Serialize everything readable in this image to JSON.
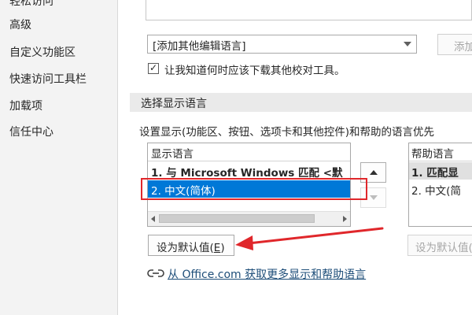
{
  "sidebar": {
    "items": [
      {
        "label": "轻松访问"
      },
      {
        "label": "高级"
      },
      {
        "label": "自定义功能区"
      },
      {
        "label": "快速访问工具栏"
      },
      {
        "label": "加载项"
      },
      {
        "label": "信任中心"
      }
    ]
  },
  "editing_language": {
    "select_value": "[添加其他编辑语言]",
    "add_button": "添加"
  },
  "proofing_notice": {
    "checked": true,
    "check_glyph": "✓",
    "label": "让我知道何时应该下载其他校对工具。"
  },
  "display_section": {
    "header": "选择显示语言",
    "description": "设置显示(功能区、按钮、选项卡和其他控件)和帮助的语言优先",
    "display_list": {
      "header": "显示语言",
      "rows": [
        {
          "label": "1.    与 Microsoft Windows 匹配 <默"
        },
        {
          "label": "2.    中文(简体)",
          "selected": true
        }
      ]
    },
    "help_list": {
      "header": "帮助语言",
      "rows": [
        {
          "label": "1.    匹配显"
        },
        {
          "label": "2.    中文(简"
        }
      ]
    },
    "set_default_button": {
      "label": "设为默认值(",
      "access_key": "E",
      "suffix": ")"
    },
    "help_set_default_button": "设为默认值(",
    "more_link": "从 Office.com 获取更多显示和帮助语言"
  },
  "colors": {
    "highlight": "#e0272b",
    "selection": "#0078d7",
    "link": "#1e4e79"
  }
}
